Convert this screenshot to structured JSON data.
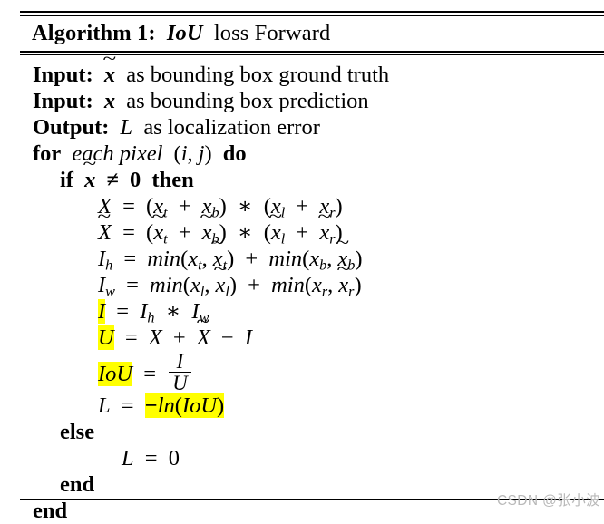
{
  "document": {
    "type": "algorithm-pseudocode-block",
    "caption_prefix": "Algorithm 1:",
    "caption_math": "IoU",
    "caption_suffix": "loss Forward",
    "watermark": "CSDN @张小波",
    "highlight_color": "#FFFF00",
    "text_color": "#000000",
    "background_color": "#FFFFFF"
  },
  "lines": {
    "input1": {
      "keyword": "Input:",
      "var": "x",
      "text": "as bounding box ground truth"
    },
    "input2": {
      "keyword": "Input:",
      "var": "x",
      "text": "as bounding box prediction"
    },
    "output": {
      "keyword": "Output:",
      "var": "L",
      "text": "as localization error"
    },
    "for": {
      "keyword": "for",
      "subject": "each pixel",
      "index_open": "(",
      "index_i": "i",
      "index_comma": ",",
      "index_j": "j",
      "index_close": ")",
      "keyword_end": "do"
    },
    "if": {
      "keyword": "if",
      "var": "x",
      "op": "≠",
      "value": "0",
      "keyword_end": "then"
    },
    "eq_X": {
      "lhs": "X",
      "eq": "=",
      "open1": "(",
      "t1": "x",
      "t1sub": "t",
      "plus1": "+",
      "t2": "x",
      "t2sub": "b",
      "close1": ")",
      "times": "∗",
      "open2": "(",
      "t3": "x",
      "t3sub": "l",
      "plus2": "+",
      "t4": "x",
      "t4sub": "r",
      "close2": ")"
    },
    "eq_Xtilde": {
      "lhs": "X",
      "eq": "=",
      "open1": "(",
      "t1": "x",
      "t1sub": "t",
      "plus1": "+",
      "t2": "x",
      "t2sub": "b",
      "close1": ")",
      "times": "∗",
      "open2": "(",
      "t3": "x",
      "t3sub": "l",
      "plus2": "+",
      "t4": "x",
      "t4sub": "r",
      "close2": ")"
    },
    "eq_Ih": {
      "lhs": "I",
      "lhs_sub": "h",
      "eq": "=",
      "fn1": "min",
      "a1": "x",
      "a1sub": "t",
      "a2": "x",
      "a2sub": "t",
      "plus": "+",
      "fn2": "min",
      "b1": "x",
      "b1sub": "b",
      "b2": "x",
      "b2sub": "b"
    },
    "eq_Iw": {
      "lhs": "I",
      "lhs_sub": "w",
      "eq": "=",
      "fn1": "min",
      "a1": "x",
      "a1sub": "l",
      "a2": "x",
      "a2sub": "l",
      "plus": "+",
      "fn2": "min",
      "b1": "x",
      "b1sub": "r",
      "b2": "x",
      "b2sub": "r"
    },
    "eq_I": {
      "lhs": "I",
      "eq": "=",
      "r1": "I",
      "r1sub": "h",
      "times": "∗",
      "r2": "I",
      "r2sub": "w",
      "highlighted": true
    },
    "eq_U": {
      "lhs": "U",
      "eq": "=",
      "r1": "X",
      "plus": "+",
      "r2": "X",
      "minus": "−",
      "r3": "I",
      "highlighted": true
    },
    "eq_IoU": {
      "lhs": "IoU",
      "eq": "=",
      "num": "I",
      "den": "U",
      "highlighted": true
    },
    "eq_L": {
      "lhs": "L",
      "eq": "=",
      "rhs_minus": "−",
      "rhs_fn": "ln",
      "rhs_open": "(",
      "rhs_arg": "IoU",
      "rhs_close": ")",
      "highlighted": true
    },
    "else": {
      "keyword": "else"
    },
    "eq_L0": {
      "lhs": "L",
      "eq": "=",
      "rhs": "0"
    },
    "end_inner": {
      "keyword": "end"
    },
    "end_outer": {
      "keyword": "end"
    }
  }
}
